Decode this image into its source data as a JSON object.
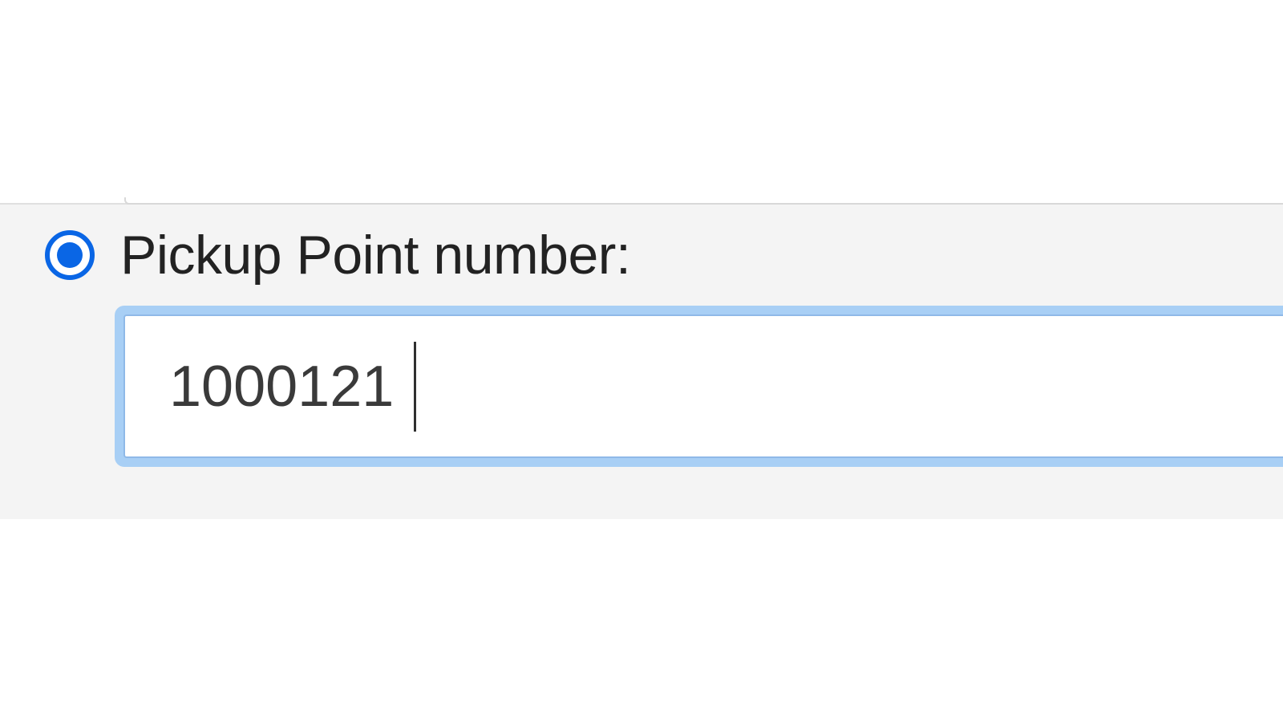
{
  "form": {
    "pickup_point": {
      "label": "Pickup Point number:",
      "value": "1000121",
      "selected": true
    }
  }
}
